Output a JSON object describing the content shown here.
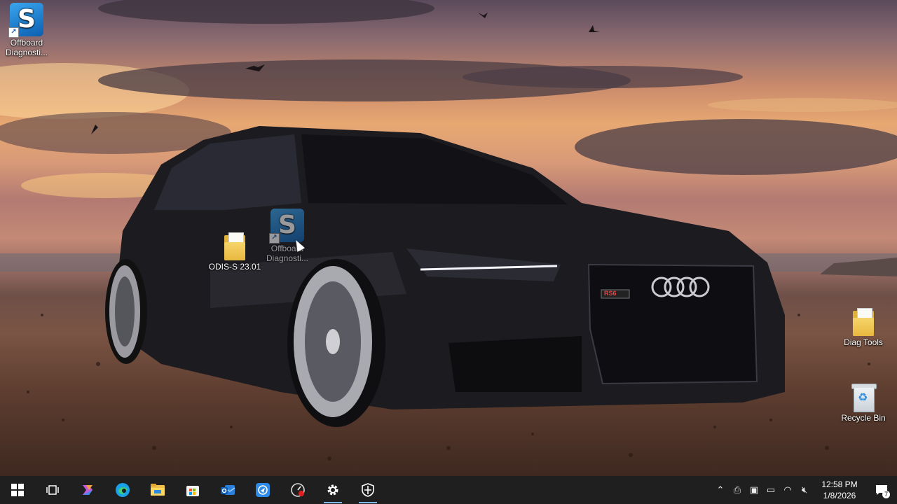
{
  "desktop": {
    "icons": [
      {
        "id": "offboard-top",
        "label": "Offboard Diagnosti..."
      },
      {
        "id": "odis-folder",
        "label": "ODIS-S 23.01"
      },
      {
        "id": "offboard-drag",
        "label": "Offboard Diagnosti..."
      },
      {
        "id": "diag-tools",
        "label": "Diag Tools"
      },
      {
        "id": "recycle-bin",
        "label": "Recycle Bin"
      }
    ],
    "wallpaper_badge": "RS6"
  },
  "taskbar": {
    "pinned": [
      {
        "name": "start-icon"
      },
      {
        "name": "task-view-icon"
      },
      {
        "name": "copilot-icon"
      },
      {
        "name": "edge-icon"
      },
      {
        "name": "file-explorer-icon"
      },
      {
        "name": "microsoft-store-icon"
      },
      {
        "name": "outlook-icon"
      },
      {
        "name": "remote-app-icon"
      },
      {
        "name": "diagnostic-app-icon"
      },
      {
        "name": "settings-icon"
      },
      {
        "name": "security-icon"
      }
    ],
    "clock": {
      "time": "12:58 PM",
      "date": "1/8/2026"
    },
    "notification_count": "7"
  },
  "colors": {
    "taskbar_bg": "#1f1f1f",
    "accent": "#7fb8ef",
    "odis_blue": "#1f7fd6"
  }
}
